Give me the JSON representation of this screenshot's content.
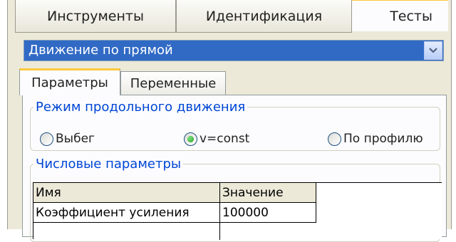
{
  "top_tabs": [
    {
      "label": "Инструменты"
    },
    {
      "label": "Идентификация"
    },
    {
      "label": "Тесты",
      "active": true
    }
  ],
  "test_select": {
    "value": "Движение по прямой"
  },
  "inner_tabs": [
    {
      "label": "Параметры",
      "active": true
    },
    {
      "label": "Переменные"
    }
  ],
  "motion_mode": {
    "legend": "Режим продольного движения",
    "options": [
      {
        "label": "Выбег",
        "selected": false
      },
      {
        "label": "v=const",
        "selected": true
      },
      {
        "label": "По профилю",
        "selected": false
      }
    ]
  },
  "numeric_params": {
    "legend": "Числовые параметры",
    "columns": [
      "Имя",
      "Значение"
    ],
    "rows": [
      {
        "name": "Коэффициент усиления",
        "value": "100000"
      }
    ]
  },
  "colors": {
    "accent": "#ffc83c",
    "selection": "#316ac5",
    "legend": "#0046d5"
  }
}
